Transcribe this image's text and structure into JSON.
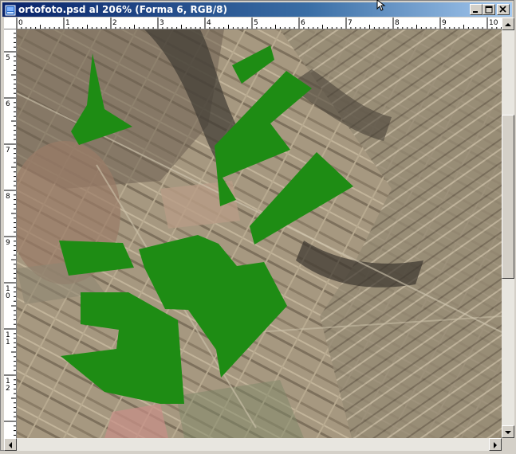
{
  "window": {
    "title": "ortofoto.psd al 206% (Forma 6, RGB/8)",
    "app_icon": "photoshop-document-icon",
    "buttons": {
      "minimize": "minimize-icon",
      "maximize": "maximize-icon",
      "close": "close-icon"
    }
  },
  "ruler_h": {
    "labels": [
      "0",
      "1",
      "2",
      "3",
      "4",
      "5",
      "6",
      "7",
      "8",
      "9",
      "10"
    ]
  },
  "ruler_v": {
    "labels": [
      "5",
      "6",
      "7",
      "8",
      "9",
      "1\n0",
      "1\n1",
      "1\n2"
    ]
  },
  "colors": {
    "shape_fill": "#1e8c14",
    "title_start": "#0a246a",
    "title_end": "#a6caf0"
  },
  "scroll": {
    "vertical_position": 0.3,
    "horizontal_position": 0.0
  }
}
